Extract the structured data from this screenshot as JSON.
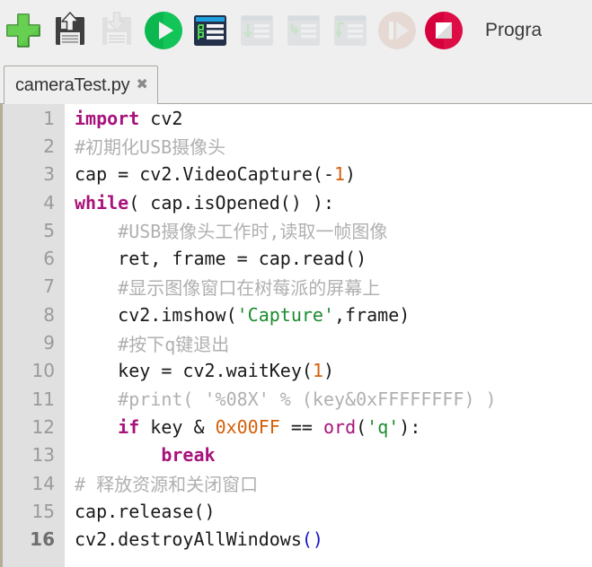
{
  "toolbar": {
    "items": [
      {
        "name": "new-file-button",
        "icon": "green-plus-icon",
        "label": "New",
        "enabled": true
      },
      {
        "name": "save-file-button",
        "icon": "floppy-save-icon",
        "label": "Save",
        "enabled": true
      },
      {
        "name": "load-file-button",
        "icon": "floppy-load-icon",
        "label": "Load",
        "enabled": false
      },
      {
        "name": "run-button",
        "icon": "green-play-icon",
        "label": "Run",
        "enabled": true
      },
      {
        "name": "debug-button",
        "icon": "debug-window-icon",
        "label": "Debug",
        "enabled": true
      },
      {
        "name": "step-into-button",
        "icon": "step-into-arrow-icon",
        "label": "Step Into",
        "enabled": false
      },
      {
        "name": "step-over-button",
        "icon": "step-over-arrow-icon",
        "label": "Step Over",
        "enabled": false
      },
      {
        "name": "step-out-button",
        "icon": "step-out-arrow-icon",
        "label": "Step Out",
        "enabled": false
      },
      {
        "name": "resume-button",
        "icon": "resume-play-icon",
        "label": "Resume",
        "enabled": false
      },
      {
        "name": "stop-button",
        "icon": "red-stop-icon",
        "label": "Stop",
        "enabled": true
      }
    ],
    "program_label": "Progra"
  },
  "tabs": [
    {
      "label": "cameraTest.py",
      "close_icon": "✖",
      "active": true
    }
  ],
  "editor": {
    "current_line": 16,
    "lines": [
      {
        "n": "1",
        "tokens": [
          {
            "t": "import",
            "c": "kw"
          },
          {
            "t": " cv2",
            "c": ""
          }
        ]
      },
      {
        "n": "2",
        "tokens": [
          {
            "t": "#初期化USB摄像头",
            "c": "com"
          }
        ]
      },
      {
        "n": "3",
        "tokens": [
          {
            "t": "cap = cv2.VideoCapture(-",
            "c": ""
          },
          {
            "t": "1",
            "c": "num"
          },
          {
            "t": ")",
            "c": ""
          }
        ]
      },
      {
        "n": "4",
        "tokens": [
          {
            "t": "while",
            "c": "kw"
          },
          {
            "t": "( cap.isOpened() ):",
            "c": ""
          }
        ]
      },
      {
        "n": "5",
        "tokens": [
          {
            "t": "    #USB摄像头工作时,读取一帧图像",
            "c": "com"
          }
        ]
      },
      {
        "n": "6",
        "tokens": [
          {
            "t": "    ret, frame = cap.read()",
            "c": ""
          }
        ]
      },
      {
        "n": "7",
        "tokens": [
          {
            "t": "    #显示图像窗口在树莓派的屏幕上",
            "c": "com"
          }
        ]
      },
      {
        "n": "8",
        "tokens": [
          {
            "t": "    cv2.imshow(",
            "c": ""
          },
          {
            "t": "'Capture'",
            "c": "str"
          },
          {
            "t": ",frame)",
            "c": ""
          }
        ]
      },
      {
        "n": "9",
        "tokens": [
          {
            "t": "    #按下q键退出",
            "c": "com"
          }
        ]
      },
      {
        "n": "10",
        "tokens": [
          {
            "t": "    key = cv2.waitKey(",
            "c": ""
          },
          {
            "t": "1",
            "c": "num"
          },
          {
            "t": ")",
            "c": ""
          }
        ]
      },
      {
        "n": "11",
        "tokens": [
          {
            "t": "    #print( '%08X' % (key&0xFFFFFFFF) )",
            "c": "com"
          }
        ]
      },
      {
        "n": "12",
        "tokens": [
          {
            "t": "    ",
            "c": ""
          },
          {
            "t": "if",
            "c": "kw"
          },
          {
            "t": " key & ",
            "c": ""
          },
          {
            "t": "0x00FF",
            "c": "num"
          },
          {
            "t": " == ",
            "c": ""
          },
          {
            "t": "ord",
            "c": "bi"
          },
          {
            "t": "(",
            "c": ""
          },
          {
            "t": "'q'",
            "c": "str"
          },
          {
            "t": "):",
            "c": ""
          }
        ]
      },
      {
        "n": "13",
        "tokens": [
          {
            "t": "        ",
            "c": ""
          },
          {
            "t": "break",
            "c": "kw"
          }
        ]
      },
      {
        "n": "14",
        "tokens": [
          {
            "t": "# 释放资源和关闭窗口",
            "c": "com"
          }
        ]
      },
      {
        "n": "15",
        "tokens": [
          {
            "t": "cap.release()",
            "c": ""
          }
        ]
      },
      {
        "n": "16",
        "tokens": [
          {
            "t": "cv2.destroyAllWindows",
            "c": ""
          },
          {
            "t": "()",
            "c": "brk"
          }
        ]
      }
    ]
  },
  "colors": {
    "keyword": "#a8127a",
    "string": "#1d8c2e",
    "number": "#d4600b",
    "comment": "#b0b0b0",
    "bracket_match": "#1414c8",
    "gutter_bg": "#e0e0e0",
    "toolbar_bg": "#efefef",
    "editor_border": "#b5ad96"
  }
}
